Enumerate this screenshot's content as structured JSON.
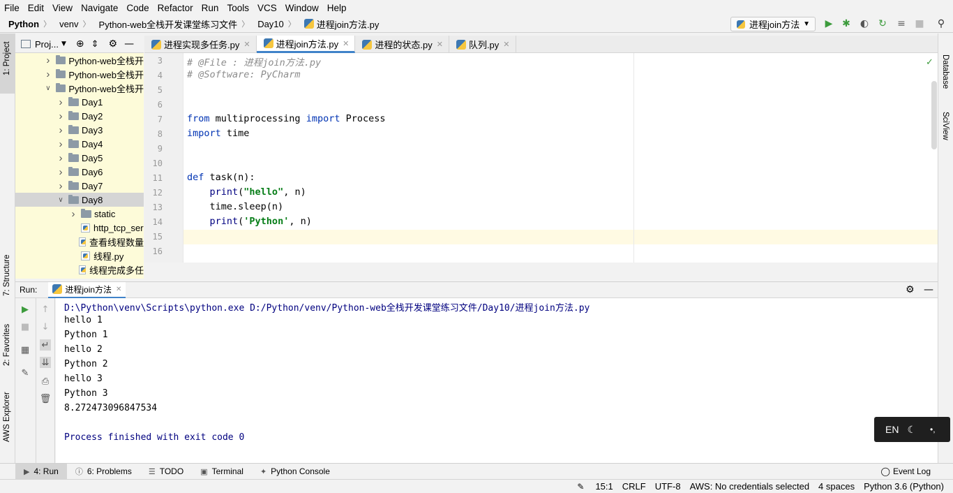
{
  "menu": [
    "File",
    "Edit",
    "View",
    "Navigate",
    "Code",
    "Refactor",
    "Run",
    "Tools",
    "VCS",
    "Window",
    "Help"
  ],
  "breadcrumb": [
    "Python",
    "venv",
    "Python-web全栈开发课堂练习文件",
    "Day10",
    "进程join方法.py"
  ],
  "run_config": "进程join方法",
  "left_strip": [
    "1: Project",
    "7: Structure",
    "2: Favorites",
    "AWS Explorer"
  ],
  "right_strip": [
    "Database",
    "SciView"
  ],
  "project_panel": {
    "title": "Proj...",
    "tree": [
      {
        "label": "Python-web全栈开",
        "indent": 0,
        "arrow": "›",
        "type": "folder",
        "selected": false
      },
      {
        "label": "Python-web全栈开",
        "indent": 0,
        "arrow": "›",
        "type": "folder",
        "selected": false
      },
      {
        "label": "Python-web全栈开",
        "indent": 0,
        "arrow": "⌄",
        "type": "folder",
        "selected": false
      },
      {
        "label": "Day1",
        "indent": 1,
        "arrow": "›",
        "type": "folder",
        "selected": false
      },
      {
        "label": "Day2",
        "indent": 1,
        "arrow": "›",
        "type": "folder",
        "selected": false
      },
      {
        "label": "Day3",
        "indent": 1,
        "arrow": "›",
        "type": "folder",
        "selected": false
      },
      {
        "label": "Day4",
        "indent": 1,
        "arrow": "›",
        "type": "folder",
        "selected": false
      },
      {
        "label": "Day5",
        "indent": 1,
        "arrow": "›",
        "type": "folder",
        "selected": false
      },
      {
        "label": "Day6",
        "indent": 1,
        "arrow": "›",
        "type": "folder",
        "selected": false
      },
      {
        "label": "Day7",
        "indent": 1,
        "arrow": "›",
        "type": "folder",
        "selected": false
      },
      {
        "label": "Day8",
        "indent": 1,
        "arrow": "⌄",
        "type": "folder",
        "selected": true
      },
      {
        "label": "static",
        "indent": 2,
        "arrow": "›",
        "type": "folder",
        "selected": false
      },
      {
        "label": "http_tcp_ser",
        "indent": 2,
        "arrow": "",
        "type": "py",
        "selected": false
      },
      {
        "label": "查看线程数量",
        "indent": 2,
        "arrow": "",
        "type": "py",
        "selected": false
      },
      {
        "label": "线程.py",
        "indent": 2,
        "arrow": "",
        "type": "py",
        "selected": false
      },
      {
        "label": "线程完成多任",
        "indent": 2,
        "arrow": "",
        "type": "py",
        "selected": false
      }
    ]
  },
  "tabs": [
    {
      "label": "进程实现多任务.py",
      "active": false
    },
    {
      "label": "进程join方法.py",
      "active": true
    },
    {
      "label": "进程的状态.py",
      "active": false
    },
    {
      "label": "队列.py",
      "active": false
    }
  ],
  "editor": {
    "line_numbers": [
      "3",
      "4",
      "5",
      "6",
      "7",
      "8",
      "9",
      "10",
      "11",
      "12",
      "13",
      "14",
      "15",
      "16"
    ],
    "lines": [
      [
        {
          "t": "# @File : 进程join方法.py",
          "c": "cm"
        }
      ],
      [
        {
          "t": "# @Software: PyCharm",
          "c": "cm"
        }
      ],
      [],
      [],
      [
        {
          "t": "from",
          "c": "kw"
        },
        {
          "t": " multiprocessing ",
          "c": ""
        },
        {
          "t": "import",
          "c": "kw"
        },
        {
          "t": " Process",
          "c": ""
        }
      ],
      [
        {
          "t": "import",
          "c": "kw"
        },
        {
          "t": " time",
          "c": ""
        }
      ],
      [],
      [],
      [
        {
          "t": "def",
          "c": "kw"
        },
        {
          "t": " task(n):",
          "c": ""
        }
      ],
      [
        {
          "t": "    ",
          "c": ""
        },
        {
          "t": "print",
          "c": "bi"
        },
        {
          "t": "(",
          "c": ""
        },
        {
          "t": "\"hello\"",
          "c": "str"
        },
        {
          "t": ", n)",
          "c": ""
        }
      ],
      [
        {
          "t": "    time.sleep(n)",
          "c": ""
        }
      ],
      [
        {
          "t": "    ",
          "c": ""
        },
        {
          "t": "print",
          "c": "bi"
        },
        {
          "t": "(",
          "c": ""
        },
        {
          "t": "'Python'",
          "c": "str"
        },
        {
          "t": ", n)",
          "c": ""
        }
      ],
      [],
      []
    ]
  },
  "run_panel": {
    "label": "Run:",
    "tab": "进程join方法",
    "output": [
      {
        "t": "D:\\Python\\venv\\Scripts\\python.exe D:/Python/venv/Python-web全栈开发课堂练习文件/Day10/进程join方法.py",
        "c": "blue"
      },
      {
        "t": "hello 1",
        "c": ""
      },
      {
        "t": "Python 1",
        "c": ""
      },
      {
        "t": "hello 2",
        "c": ""
      },
      {
        "t": "Python 2",
        "c": ""
      },
      {
        "t": "hello 3",
        "c": ""
      },
      {
        "t": "Python 3",
        "c": ""
      },
      {
        "t": "8.272473096847534",
        "c": ""
      },
      {
        "t": "",
        "c": ""
      },
      {
        "t": "Process finished with exit code 0",
        "c": "blue"
      }
    ]
  },
  "bottom_tabs": [
    {
      "label": "4: Run",
      "icon": "run-icon",
      "active": true
    },
    {
      "label": "6: Problems",
      "icon": "problems-icon",
      "active": false
    },
    {
      "label": "TODO",
      "icon": "todo-icon",
      "active": false
    },
    {
      "label": "Terminal",
      "icon": "terminal-icon",
      "active": false
    },
    {
      "label": "Python Console",
      "icon": "python-console-icon",
      "active": false
    }
  ],
  "event_log": "Event Log",
  "status": {
    "position": "15:1",
    "line_sep": "CRLF",
    "encoding": "UTF-8",
    "aws": "AWS: No credentials selected",
    "indent": "4 spaces",
    "interpreter": "Python 3.6 (Python)"
  },
  "ime": {
    "lang": "EN"
  },
  "colors": {
    "tree_bg": "#fdfbd9",
    "keyword": "#0033b3",
    "string": "#067d17",
    "comment": "#8c8c8c",
    "run_green": "#3c9b3c"
  }
}
